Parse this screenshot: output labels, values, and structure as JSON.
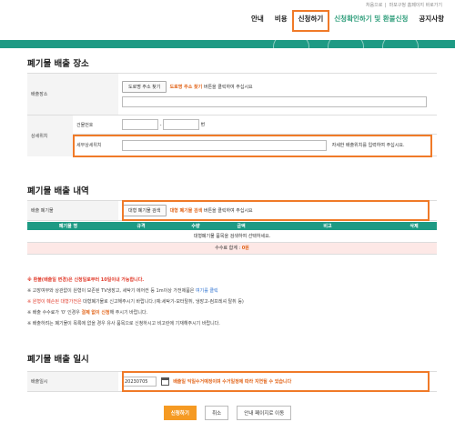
{
  "top_links": [
    "처음으로",
    "마포구청 홈페이지 바로가기"
  ],
  "nav": [
    {
      "label": "안내",
      "style": "normal"
    },
    {
      "label": "비용",
      "style": "normal"
    },
    {
      "label": "신청하기",
      "style": "highlight"
    },
    {
      "label": "신청확인하기 및 환불신청",
      "style": "green"
    },
    {
      "label": "공지사항",
      "style": "normal"
    }
  ],
  "colors": {
    "accent": "#f07a28",
    "green": "#1e9a84",
    "orange_text": "#e2651a"
  },
  "location": {
    "title": "폐기물 배출 장소",
    "place_label": "배출장소",
    "road_button": "도로명 주소 찾기",
    "road_hint_bold": "도로명 주소 찾기",
    "road_hint": "버튼을 클릭하여 주십시요",
    "detail_label": "상세위치",
    "building_label": "건물번호",
    "building_suffix": "번",
    "detail_sub_label": "세부상세위치",
    "detail_hint": "자세한 배출위치를 입력하여 주십시요."
  },
  "items": {
    "title": "폐기물 배출 내역",
    "label": "배출 폐기물",
    "search_button": "대형 폐기물 검색",
    "search_hint_bold": "대형 폐기물 검색",
    "search_hint": "버튼을 클릭하여 주십시요",
    "columns": [
      "폐기물 명",
      "규격",
      "수량",
      "금액",
      "비고",
      "삭제"
    ],
    "empty_text": "대형폐기물 품목을 검색하여 선택하세요.",
    "sum_label": "수수료 합계 :",
    "sum_value": "0원"
  },
  "notes": {
    "n1": "※ 환불(배출일 변경)은 신청일로부터 10일이내 가능합니다.",
    "n2a": "※ 고장여부와 상관없이 원형이 보존된 TV냉장고, 세탁기 에어컨 등 1m이상 가전제품은 ",
    "n2b": "여기를 클릭",
    "n3a": "※ 원형이 훼손된 대형가전은",
    "n3b": " 대형폐기물로 신고해주시기 바랍니다.(예:세탁기-모터탈취, 냉장고-컴프레셔 탈취 등)",
    "n4a": "※ 배출 수수료가 '0' 인경우 ",
    "n4b": "결제 없이 신청",
    "n4c": "해 주시기 바랍니다.",
    "n5": "※ 배출하려는 폐기물이 목록에 없을 경우 유사 품목으로 신청하시고 비고란에 기재해주시기 바랍니다."
  },
  "date": {
    "title": "폐기물 배출 일시",
    "label": "배출일시",
    "value": "20230705",
    "hint": "배출일 익일수거예정이며 수거일정에 따라 지연될 수 있습니다"
  },
  "actions": {
    "submit": "신청하기",
    "cancel": "취소",
    "info": "안내 페이지로 이동"
  }
}
